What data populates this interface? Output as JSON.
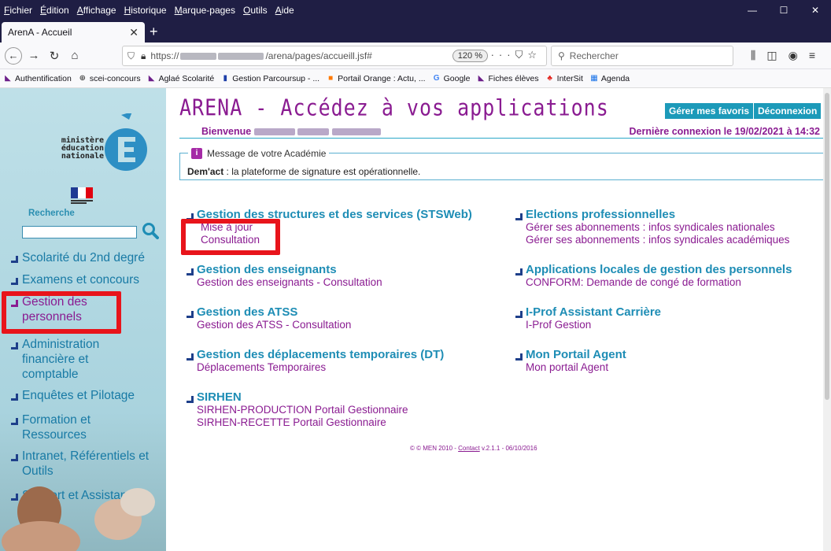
{
  "browser": {
    "menu": [
      "Fichier",
      "Édition",
      "Affichage",
      "Historique",
      "Marque-pages",
      "Outils",
      "Aide"
    ],
    "tab_title": "ArenA - Accueil",
    "url_prefix": "https://",
    "url_path": "/arena/pages/accueill.jsf#",
    "zoom": "120 %",
    "search_placeholder": "Rechercher",
    "bookmarks": [
      {
        "label": "Authentification",
        "icon": "bookmark-arrow-icon",
        "color": "#6d1f8a"
      },
      {
        "label": "scei-concours",
        "icon": "globe-icon",
        "color": "#555555"
      },
      {
        "label": "Aglaé Scolarité",
        "icon": "bookmark-arrow-icon",
        "color": "#6d1f8a"
      },
      {
        "label": "Gestion Parcoursup - ...",
        "icon": "flag-icon",
        "color": "#1e3fa8"
      },
      {
        "label": "Portail Orange : Actu, ...",
        "icon": "orange-square-icon",
        "color": "#ff7900"
      },
      {
        "label": "Google",
        "icon": "google-icon",
        "color": "#4285f4"
      },
      {
        "label": "Fiches élèves",
        "icon": "bookmark-arrow-icon",
        "color": "#6d1f8a"
      },
      {
        "label": "InterSit",
        "icon": "shell-icon",
        "color": "#e2201a"
      },
      {
        "label": "Agenda",
        "icon": "calendar-icon",
        "color": "#1a73e8"
      }
    ]
  },
  "sidebar": {
    "logo_lines": [
      "ministère",
      "éducation",
      "nationale"
    ],
    "search_label": "Recherche",
    "items": [
      {
        "label": "Scolarité du 2nd degré"
      },
      {
        "label": "Examens et concours"
      },
      {
        "label": "Gestion des personnels"
      },
      {
        "label": "Administration financière et comptable"
      },
      {
        "label": "Enquêtes et Pilotage"
      },
      {
        "label": "Formation et Ressources"
      },
      {
        "label": "Intranet, Référentiels et Outils"
      },
      {
        "label": "Support et Assistance"
      }
    ]
  },
  "header": {
    "title": "ARENA - Accédez à vos applications",
    "fav_button": "Gérer mes favoris",
    "logout_button": "Déconnexion",
    "welcome": "Bienvenue",
    "last_login": "Dernière connexion le 19/02/2021 à  14:32"
  },
  "message": {
    "legend": "Message de votre Académie",
    "bold": "Dem'act",
    "text": " : la plateforme de signature est opérationnelle."
  },
  "sections_left": [
    {
      "title": "Gestion des structures et des services (STSWeb)",
      "links": [
        "Mise à jour",
        "Consultation"
      ]
    },
    {
      "title": "Gestion des enseignants",
      "links": [
        "Gestion des enseignants - Consultation"
      ]
    },
    {
      "title": "Gestion des ATSS",
      "links": [
        "Gestion des ATSS - Consultation"
      ]
    },
    {
      "title": "Gestion des déplacements temporaires (DT)",
      "links": [
        "Déplacements Temporaires"
      ]
    },
    {
      "title": "SIRHEN",
      "links": [
        "SIRHEN-PRODUCTION Portail Gestionnaire",
        "SIRHEN-RECETTE Portail Gestionnaire"
      ]
    }
  ],
  "sections_right": [
    {
      "title": "Elections professionnelles",
      "links": [
        "Gérer ses abonnements : infos syndicales nationales",
        "Gérer ses abonnements : infos syndicales académiques"
      ]
    },
    {
      "title": "Applications locales de gestion des personnels",
      "links": [
        "CONFORM: Demande de congé de formation"
      ]
    },
    {
      "title": "I-Prof Assistant Carrière",
      "links": [
        "I-Prof Gestion"
      ]
    },
    {
      "title": "Mon Portail Agent",
      "links": [
        "Mon portail Agent"
      ]
    }
  ],
  "footer": {
    "copyright": "© © MEN 2010 - ",
    "contact": "Contact",
    "version": " v.2.1.1 - 06/10/2016"
  },
  "colors": {
    "accent": "#1c9ab9",
    "title": "#8a1b91",
    "highlight": "#e8141b"
  }
}
